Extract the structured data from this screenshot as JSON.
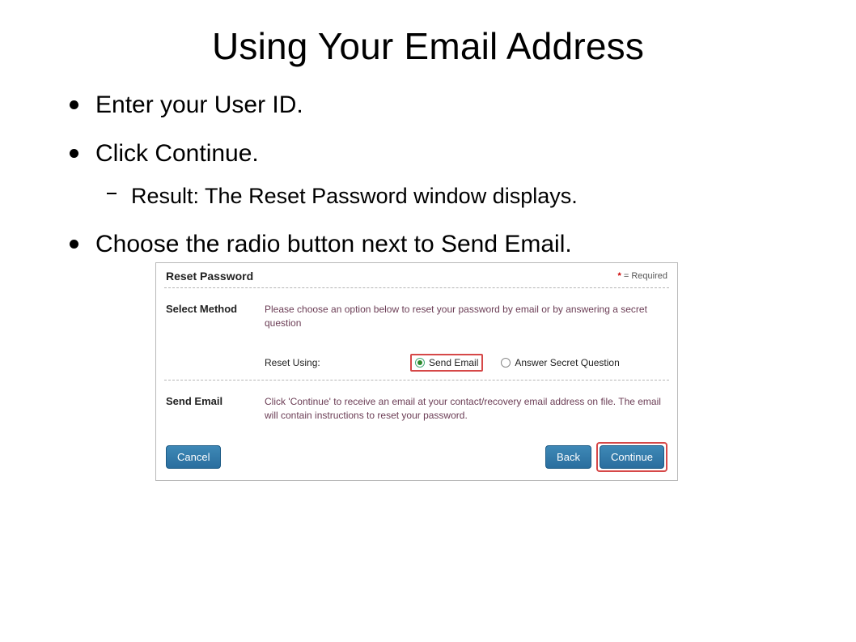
{
  "title": "Using Your Email Address",
  "bullets": {
    "b1": "Enter your User ID.",
    "b2": "Click Continue.",
    "b2_sub": "Result: The Reset Password window displays.",
    "b3": "Choose the radio button next to Send Email."
  },
  "panel": {
    "title": "Reset Password",
    "required_symbol": "*",
    "required_text": " = Required",
    "select_method_label": "Select Method",
    "select_method_instr": "Please choose an option below to reset your password by email or by answering a secret question",
    "reset_using_label": "Reset Using:",
    "option_send_email": "Send Email",
    "option_secret_q": "Answer Secret Question",
    "send_email_label": "Send Email",
    "send_email_instr": "Click 'Continue' to receive an email at your contact/recovery email address on file. The email will contain instructions to reset your password.",
    "btn_cancel": "Cancel",
    "btn_back": "Back",
    "btn_continue": "Continue"
  }
}
